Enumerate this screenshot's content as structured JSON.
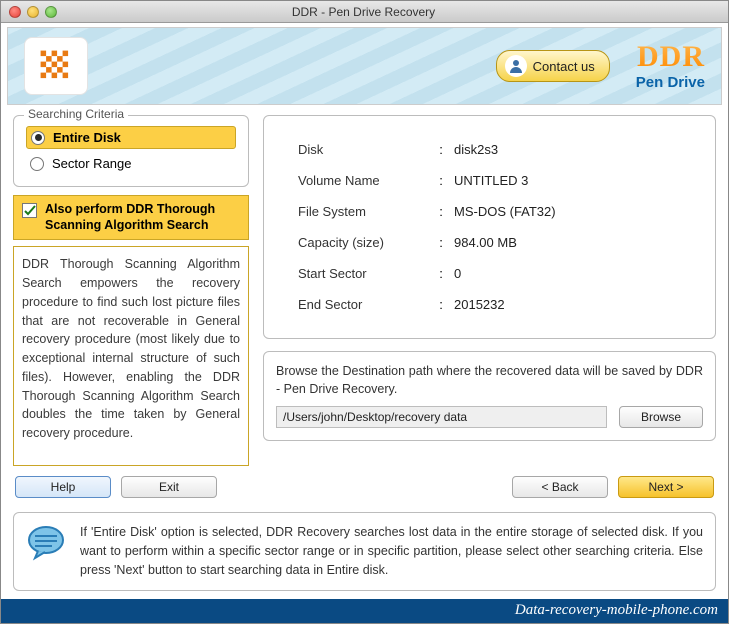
{
  "window": {
    "title": "DDR - Pen Drive Recovery"
  },
  "header": {
    "contact": "Contact us",
    "brand_top": "DDR",
    "brand_sub": "Pen Drive"
  },
  "criteria": {
    "legend": "Searching Criteria",
    "entire_disk": "Entire Disk",
    "sector_range": "Sector Range"
  },
  "thorough": {
    "label": "Also perform DDR Thorough Scanning Algorithm Search",
    "description": "DDR Thorough Scanning Algorithm Search empowers the recovery procedure to find such lost picture files that are not recoverable in General recovery procedure (most likely due to exceptional internal structure of such files). However, enabling the DDR Thorough Scanning Algorithm Search doubles the time taken by General recovery procedure."
  },
  "info": {
    "rows": [
      {
        "key": "Disk",
        "val": "disk2s3"
      },
      {
        "key": "Volume Name",
        "val": "UNTITLED 3"
      },
      {
        "key": "File System",
        "val": "MS-DOS (FAT32)"
      },
      {
        "key": "Capacity (size)",
        "val": "984.00  MB"
      },
      {
        "key": "Start Sector",
        "val": "0"
      },
      {
        "key": "End Sector",
        "val": "2015232"
      }
    ]
  },
  "dest": {
    "text": "Browse the Destination path where the recovered data will be saved by DDR - Pen Drive Recovery.",
    "path": "/Users/john/Desktop/recovery data",
    "browse": "Browse"
  },
  "actions": {
    "help": "Help",
    "exit": "Exit",
    "back": "< Back",
    "next": "Next >"
  },
  "tip": "If 'Entire Disk' option is selected, DDR Recovery searches lost data in the entire storage of selected disk. If you want to perform within a specific sector range or in specific partition, please select other searching criteria. Else press 'Next' button to start searching data in Entire disk.",
  "footer": "Data-recovery-mobile-phone.com"
}
